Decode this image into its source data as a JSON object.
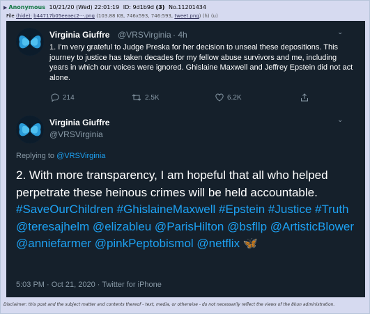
{
  "post": {
    "arrow": "▶",
    "name": "Anonymous",
    "datetime": "10/21/20 (Wed) 22:01:19",
    "id_label": "ID:",
    "id": "9d1b9d",
    "id_count": "(3)",
    "number": "No.11201434"
  },
  "file": {
    "label": "File",
    "hide": "(hide):",
    "filename": "b44717b05eeaec2···.png",
    "info": "(103.88 KB, 746x593, 746:593,",
    "tweet_link": "tweet.png",
    "tail": ") (h) (u)"
  },
  "tweet1": {
    "author": "Virginia Giuffre",
    "handle": "@VRSVirginia",
    "time": "· 4h",
    "caret": "⌄",
    "text": "1. I'm very grateful to Judge Preska for her decision to unseal these depositions. This journey to justice has taken decades for my fellow abuse survivors and me, including years in which our voices were ignored. Ghislaine Maxwell and Jeffrey Epstein did not act alone.",
    "replies": "214",
    "retweets": "2.5K",
    "likes": "6.2K"
  },
  "tweet2": {
    "author": "Virginia Giuffre",
    "handle": "@VRSVirginia",
    "caret": "⌄",
    "replying_label": "Replying to",
    "replying_handle": "@VRSVirginia",
    "text_plain": "2. With more transparency, I am hopeful that all who helped perpetrate these heinous crimes will be held accountable.",
    "tags": "#SaveOurChildren #GhislaineMaxwell #Epstein #Justice #Truth @teresajhelm @elizableu @ParisHilton @bsfllp @ArtisticBlower @anniefarmer @pinkPeptobismol @netflix",
    "emoji": "🦋",
    "meta": "5:03 PM · Oct 21, 2020 · Twitter for iPhone"
  },
  "disclaimer": "Disclaimer: this post and the subject matter and contents thereof - text, media, or otherwise - do not necessarily reflect the views of the 8kun administration.",
  "icons": {
    "reply": "reply-icon",
    "retweet": "retweet-icon",
    "like": "heart-icon",
    "share": "share-icon"
  },
  "colors": {
    "tweet_bg": "#15202b",
    "link": "#1da1f2",
    "muted": "#8899a6",
    "post_bg": "#d6daf0",
    "name_green": "#117743"
  }
}
